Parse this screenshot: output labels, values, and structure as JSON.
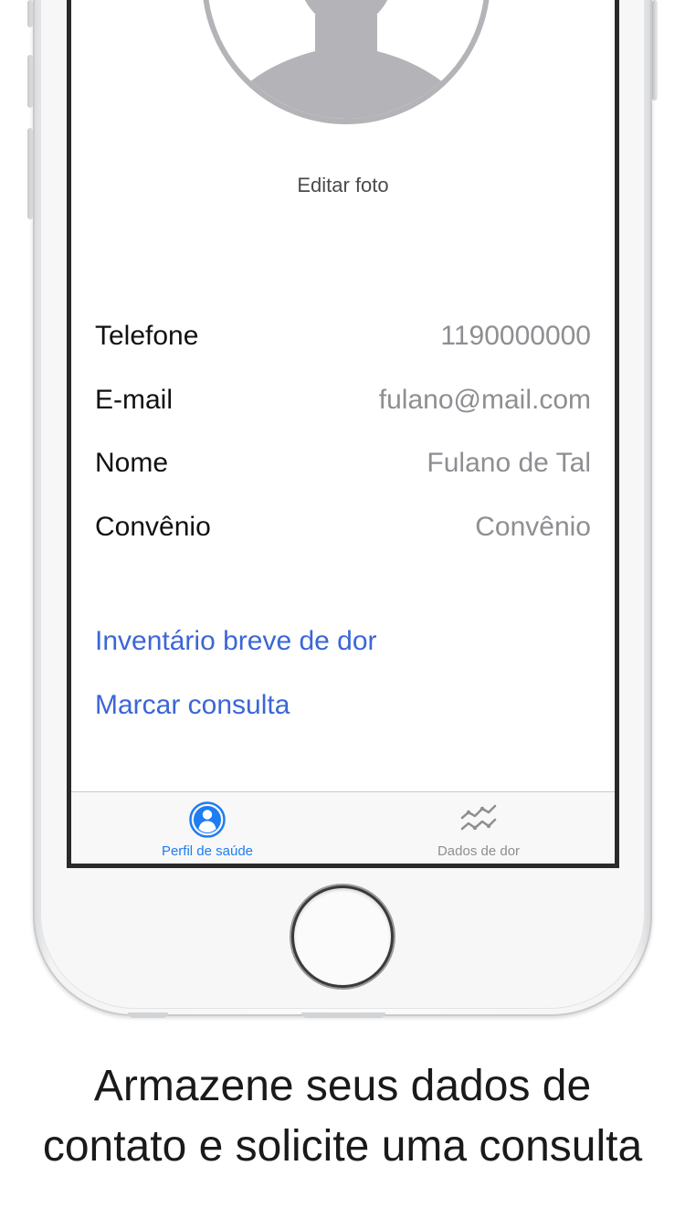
{
  "profile": {
    "edit_photo_label": "Editar foto"
  },
  "fields": [
    {
      "label": "Telefone",
      "value": "1190000000"
    },
    {
      "label": "E-mail",
      "value": "fulano@mail.com"
    },
    {
      "label": "Nome",
      "value": "Fulano de Tal"
    },
    {
      "label": "Convênio",
      "value": "Convênio"
    }
  ],
  "actions": {
    "pain_inventory": "Inventário breve de dor",
    "schedule_appointment": "Marcar consulta"
  },
  "tabbar": {
    "tabs": [
      {
        "label": "Perfil de saúde",
        "icon": "person-circle-icon",
        "active": true
      },
      {
        "label": "Dados de dor",
        "icon": "chart-lines-icon",
        "active": false
      }
    ]
  },
  "caption": {
    "line1": "Armazene seus dados de",
    "line2": "contato e solicite uma consulta"
  },
  "colors": {
    "link": "#3b66d6",
    "tab_active": "#1e7df0",
    "tab_inactive": "#8e8e93",
    "value_text": "#8e8e93"
  }
}
